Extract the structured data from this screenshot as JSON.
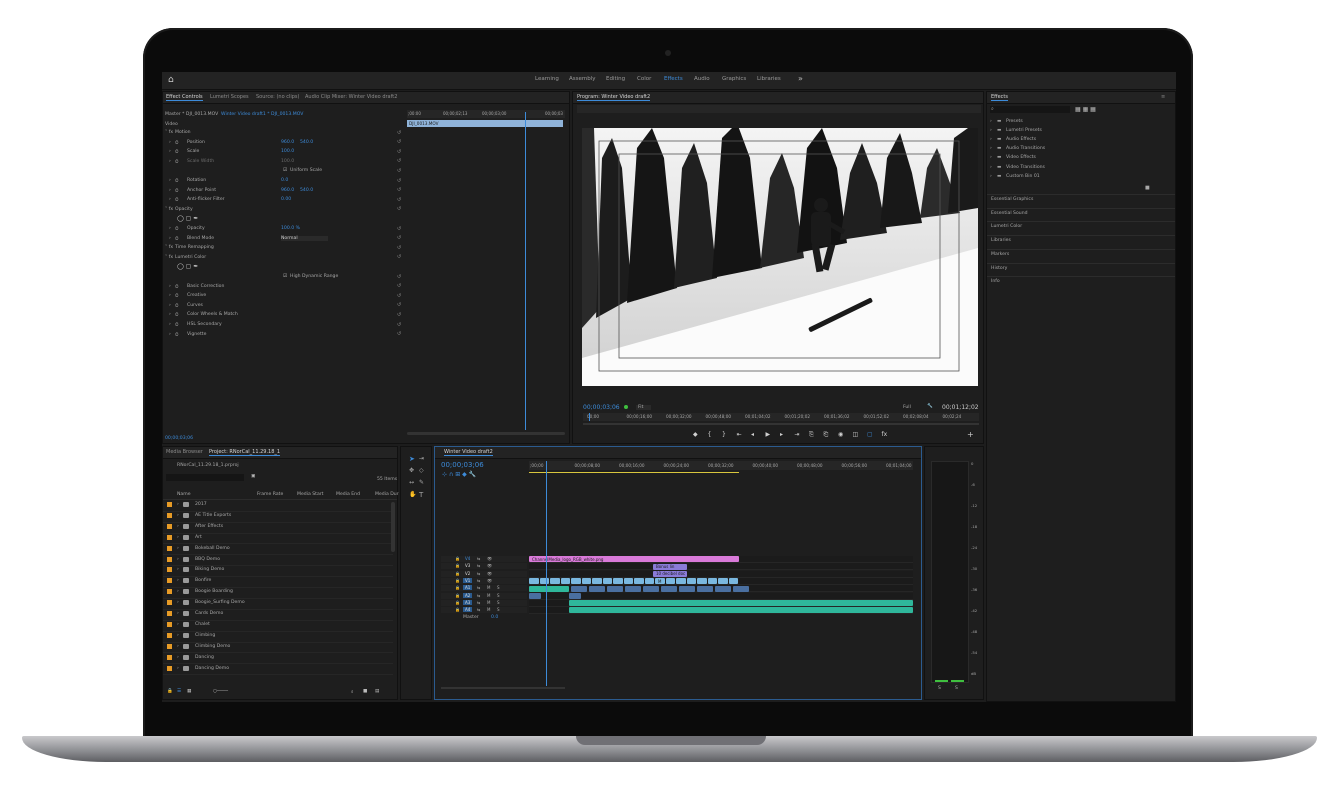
{
  "workspaces": [
    "Learning",
    "Assembly",
    "Editing",
    "Color",
    "Effects",
    "Audio",
    "Graphics",
    "Libraries"
  ],
  "active_workspace": "Effects",
  "effect_controls": {
    "tabs": [
      "Effect Controls",
      "Lumetri Scopes",
      "Source: (no clips)",
      "Audio Clip Mixer: Winter Video draft2"
    ],
    "master_label": "Master * DJI_0013.MOV",
    "clip_label": "Winter Video draft1 * DJI_0013.MOV",
    "video_header": "Video",
    "timeline_times": [
      ";00:00",
      "00;00;02;13",
      "00;00;03;00",
      "00;00;03"
    ],
    "clip_bar": "DJI_0013.MOV",
    "rows": [
      {
        "label": "Motion",
        "indent": 1
      },
      {
        "label": "Position",
        "indent": 2,
        "v1": "960.0",
        "v2": "540.0"
      },
      {
        "label": "Scale",
        "indent": 2,
        "v1": "100.0"
      },
      {
        "label": "Scale Width",
        "indent": 2,
        "v1": "100.0",
        "dim": true
      },
      {
        "label": "Uniform Scale",
        "indent": 3,
        "check": true
      },
      {
        "label": "Rotation",
        "indent": 2,
        "v1": "0.0"
      },
      {
        "label": "Anchor Point",
        "indent": 2,
        "v1": "960.0",
        "v2": "540.0"
      },
      {
        "label": "Anti-flicker Filter",
        "indent": 2,
        "v1": "0.00"
      },
      {
        "label": "Opacity",
        "indent": 1
      },
      {
        "label": "",
        "indent": 2,
        "shapes": true
      },
      {
        "label": "Opacity",
        "indent": 2,
        "v1": "100.0 %",
        "blue": true
      },
      {
        "label": "Blend Mode",
        "indent": 2,
        "v1": "Normal",
        "select": true
      },
      {
        "label": "Time Remapping",
        "indent": 1
      },
      {
        "label": "Lumetri Color",
        "indent": 1
      },
      {
        "label": "",
        "indent": 2,
        "shapes": true
      },
      {
        "label": "High Dynamic Range",
        "indent": 3,
        "check": true
      },
      {
        "label": "Basic Correction",
        "indent": 2
      },
      {
        "label": "Creative",
        "indent": 2
      },
      {
        "label": "Curves",
        "indent": 2
      },
      {
        "label": "Color Wheels & Match",
        "indent": 2
      },
      {
        "label": "HSL Secondary",
        "indent": 2
      },
      {
        "label": "Vignette",
        "indent": 2
      }
    ],
    "footer_time": "00;00;03;06"
  },
  "program": {
    "title": "Program: Winter Video draft2",
    "timecode": "00;00;03;06",
    "fit": "Fit",
    "quality": "Full",
    "duration": "00;01;12;02",
    "ruler": [
      "00;00",
      "00;00;16;00",
      "00;00;32;00",
      "00;00;48;00",
      "00;01;04;02",
      "00;01;20;02",
      "00;01;36;02",
      "00;01;52;02",
      "00;02;08;04",
      "00;02;24"
    ]
  },
  "effects_panel": {
    "title": "Effects",
    "tree": [
      "Presets",
      "Lumetri Presets",
      "Audio Effects",
      "Audio Transitions",
      "Video Effects",
      "Video Transitions",
      "Custom Bin 01"
    ],
    "sections": [
      "Essential Graphics",
      "Essential Sound",
      "Lumetri Color",
      "Libraries",
      "Markers",
      "History",
      "Info"
    ]
  },
  "project": {
    "tabs": [
      "Media Browser",
      "Project: RNorCal_11.29.18_1"
    ],
    "file": "RNorCal_11.29.18_1.prproj",
    "count": "55 Items",
    "columns": [
      "Name",
      "Frame Rate",
      "Media Start",
      "Media End",
      "Media Dur"
    ],
    "items": [
      "2017",
      "AE Title Exports",
      "After Effects",
      "Art",
      "Bokeball Demo",
      "BBQ Demo",
      "Biking Demo",
      "Bonfire",
      "Boogie Boarding",
      "Boogie_Surfing Demo",
      "Cards Demo",
      "Chalet",
      "Climbing",
      "Climbing Demo",
      "Dancing",
      "Dancing Demo"
    ]
  },
  "timeline": {
    "title": "Winter Video draft2",
    "timecode": "00;00;03;06",
    "ruler": [
      ";00;00",
      "00;00;08;00",
      "00;00;16;00",
      "00;00;24;00",
      "00;00;32;00",
      "00;00;40;00",
      "00;00;48;00",
      "00;00;56;00",
      "00;01;04;00"
    ],
    "tracks": [
      "V4",
      "V3",
      "V2",
      "V1",
      "A1",
      "A2",
      "A3",
      "A4"
    ],
    "master": "Master",
    "master_val": "0.0",
    "clips": [
      "ChannelMedia_logo_RGB_white.png",
      "Bonus lin",
      "10 decibel doc",
      "M"
    ],
    "vu_scale": [
      "0",
      "-6",
      "-12",
      "-18",
      "-24",
      "-30",
      "-36",
      "-42",
      "-48",
      "-54",
      "dB"
    ],
    "vu_bottom": [
      "S",
      "S"
    ]
  },
  "colors": {
    "accent": "#3d8bd9",
    "folder": "#e79b26",
    "clip_pink": "#d97ad9",
    "clip_blue": "#7ab8e0",
    "clip_teal": "#2fb79b",
    "clip_violet": "#8a7bd8"
  }
}
